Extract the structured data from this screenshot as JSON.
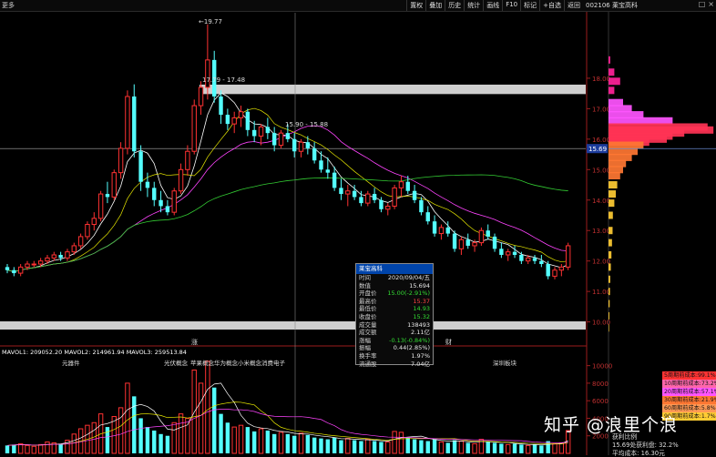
{
  "toolbar": {
    "more_label": "更多",
    "buttons": [
      "置权",
      "叠加",
      "历史",
      "统计",
      "画线",
      "F10",
      "标记",
      "+自选",
      "返回"
    ],
    "stock_title": "002106 莱宝高科"
  },
  "price_axis": {
    "ticks": [
      "18.00",
      "17.00",
      "16.00",
      "15.00",
      "14.00",
      "13.00",
      "12.00",
      "11.00",
      "10.00"
    ],
    "current_price_tag": "15.69"
  },
  "volume_axis": {
    "ticks": [
      "10000",
      "8000",
      "6000",
      "4000",
      "2000"
    ]
  },
  "chart_annotations": {
    "high_label": "19.77",
    "resistance_label": "17.79 - 17.48",
    "crosshair_label": "15.90 - 15.88",
    "event_label_1": "涨",
    "event_label_2": "财"
  },
  "volume_indicator": {
    "mavol1": "MAVOL1: 209052.20",
    "mavol2": "MAVOL2: 214961.94",
    "mavol3": "MAVOL3: 259513.84"
  },
  "concept_tags": [
    "元器件",
    "光伏概念",
    "苹果概念",
    "华为概念",
    "小米概念",
    "消费电子",
    "深圳板块"
  ],
  "popup": {
    "title": "莱宝高科",
    "rows": [
      {
        "label": "时间",
        "value": "2020/09/04/五",
        "color": "#e8e8e8"
      },
      {
        "label": "数值",
        "value": "15.694",
        "color": "#e8e8e8"
      },
      {
        "label": "开盘价",
        "value": "15.00(-2.91%)",
        "color": "#33dd33"
      },
      {
        "label": "最高价",
        "value": "15.37",
        "color": "#ff4444"
      },
      {
        "label": "最低价",
        "value": "14.93",
        "color": "#33dd33"
      },
      {
        "label": "收盘价",
        "value": "15.32",
        "color": "#33dd33"
      },
      {
        "label": "成交量",
        "value": "138493",
        "color": "#e8e8e8"
      },
      {
        "label": "成交额",
        "value": "2.11亿",
        "color": "#e8e8e8"
      },
      {
        "label": "涨幅",
        "value": "-0.13(-0.84%)",
        "color": "#33dd33"
      },
      {
        "label": "振幅",
        "value": "0.44(2.85%)",
        "color": "#e8e8e8"
      },
      {
        "label": "换手率",
        "value": "1.97%",
        "color": "#e8e8e8"
      },
      {
        "label": "流通股",
        "value": "7.04亿",
        "color": "#e8e8e8"
      }
    ]
  },
  "cost_distribution": [
    {
      "label": "5周期前成本:99.1%",
      "color": "#ff3333"
    },
    {
      "label": "10周期前成本:73.2%",
      "color": "#ff66aa"
    },
    {
      "label": "20周期前成本:57.1%",
      "color": "#ff55ff"
    },
    {
      "label": "30周期前成本:21.9%",
      "color": "#ff7733"
    },
    {
      "label": "60周期前成本:5.8%",
      "color": "#ff9955"
    },
    {
      "label": "90周期前成本:1.7%",
      "color": "#ffcc33"
    }
  ],
  "bottom_info": {
    "line1": "获利比例",
    "line2": "15.69处获利盘: 32.2%",
    "line3": "平均成本: 16.30元"
  },
  "watermark": "知乎 @浪里个浪",
  "chart_data": {
    "type": "candlestick",
    "ylim": [
      10.0,
      19.9
    ],
    "candles": [
      [
        11.8,
        11.9,
        11.6,
        11.7
      ],
      [
        11.7,
        11.8,
        11.5,
        11.6
      ],
      [
        11.6,
        11.9,
        11.5,
        11.8
      ],
      [
        11.8,
        12.0,
        11.7,
        11.9
      ],
      [
        11.9,
        12.0,
        11.8,
        11.9
      ],
      [
        11.9,
        12.1,
        11.8,
        12.0
      ],
      [
        12.0,
        12.2,
        11.9,
        12.1
      ],
      [
        12.1,
        12.3,
        12.0,
        12.2
      ],
      [
        12.2,
        12.3,
        12.0,
        12.1
      ],
      [
        12.1,
        12.4,
        12.0,
        12.3
      ],
      [
        12.3,
        12.6,
        12.2,
        12.5
      ],
      [
        12.5,
        12.9,
        12.4,
        12.8
      ],
      [
        12.8,
        13.3,
        12.7,
        13.2
      ],
      [
        13.2,
        13.6,
        13.0,
        13.4
      ],
      [
        13.4,
        14.3,
        13.3,
        14.2
      ],
      [
        14.2,
        14.6,
        13.9,
        14.1
      ],
      [
        14.1,
        15.0,
        14.0,
        14.9
      ],
      [
        14.9,
        15.9,
        14.7,
        15.7
      ],
      [
        15.7,
        17.6,
        15.5,
        17.4
      ],
      [
        17.4,
        17.8,
        15.4,
        15.6
      ],
      [
        15.6,
        15.8,
        14.3,
        14.6
      ],
      [
        14.6,
        14.9,
        14.1,
        14.4
      ],
      [
        14.4,
        14.6,
        13.8,
        14.0
      ],
      [
        14.0,
        14.3,
        13.6,
        13.8
      ],
      [
        13.8,
        14.0,
        13.5,
        13.6
      ],
      [
        13.6,
        14.4,
        13.5,
        14.3
      ],
      [
        14.3,
        15.2,
        14.2,
        15.0
      ],
      [
        15.0,
        15.8,
        14.8,
        15.6
      ],
      [
        15.6,
        17.3,
        15.5,
        17.1
      ],
      [
        17.1,
        17.9,
        16.8,
        17.7
      ],
      [
        17.7,
        19.77,
        17.3,
        18.6
      ],
      [
        18.6,
        18.9,
        17.2,
        17.4
      ],
      [
        17.4,
        17.6,
        16.5,
        16.8
      ],
      [
        16.8,
        17.0,
        16.3,
        16.5
      ],
      [
        16.5,
        16.9,
        16.2,
        16.7
      ],
      [
        16.7,
        17.1,
        16.4,
        16.9
      ],
      [
        16.9,
        17.0,
        16.1,
        16.3
      ],
      [
        16.3,
        16.6,
        15.9,
        16.1
      ],
      [
        16.1,
        16.5,
        15.8,
        16.4
      ],
      [
        16.4,
        16.7,
        16.0,
        16.2
      ],
      [
        16.2,
        16.4,
        15.6,
        15.8
      ],
      [
        15.8,
        16.3,
        15.7,
        16.2
      ],
      [
        16.2,
        16.5,
        15.9,
        16.0
      ],
      [
        16.0,
        16.2,
        15.4,
        15.6
      ],
      [
        15.6,
        16.0,
        15.4,
        15.9
      ],
      [
        15.9,
        16.1,
        15.5,
        15.7
      ],
      [
        15.7,
        15.9,
        15.2,
        15.3
      ],
      [
        15.3,
        15.6,
        14.9,
        15.0
      ],
      [
        15.0,
        15.4,
        14.7,
        14.9
      ],
      [
        14.9,
        15.1,
        14.3,
        14.4
      ],
      [
        14.4,
        14.7,
        14.0,
        14.2
      ],
      [
        14.2,
        14.5,
        13.8,
        14.3
      ],
      [
        14.3,
        14.5,
        14.0,
        14.1
      ],
      [
        14.1,
        14.3,
        13.8,
        13.9
      ],
      [
        13.9,
        14.3,
        13.8,
        14.2
      ],
      [
        14.2,
        14.4,
        13.9,
        14.0
      ],
      [
        14.0,
        14.1,
        13.6,
        13.7
      ],
      [
        13.7,
        13.9,
        13.5,
        13.8
      ],
      [
        13.8,
        14.5,
        13.7,
        14.4
      ],
      [
        14.4,
        14.8,
        14.1,
        14.6
      ],
      [
        14.6,
        14.8,
        14.2,
        14.3
      ],
      [
        14.3,
        14.5,
        13.9,
        14.0
      ],
      [
        14.0,
        14.1,
        13.5,
        13.6
      ],
      [
        13.6,
        13.8,
        13.2,
        13.3
      ],
      [
        13.3,
        13.5,
        12.8,
        12.9
      ],
      [
        12.9,
        13.2,
        12.7,
        13.1
      ],
      [
        13.1,
        13.3,
        12.8,
        12.9
      ],
      [
        12.9,
        13.0,
        12.3,
        12.4
      ],
      [
        12.4,
        12.8,
        12.2,
        12.7
      ],
      [
        12.7,
        12.9,
        12.4,
        12.5
      ],
      [
        12.5,
        12.7,
        12.3,
        12.6
      ],
      [
        12.6,
        13.1,
        12.5,
        13.0
      ],
      [
        13.0,
        13.2,
        12.7,
        12.8
      ],
      [
        12.8,
        12.9,
        12.3,
        12.4
      ],
      [
        12.4,
        12.6,
        12.1,
        12.2
      ],
      [
        12.2,
        12.4,
        12.0,
        12.3
      ],
      [
        12.3,
        12.5,
        12.1,
        12.2
      ],
      [
        12.2,
        12.3,
        11.9,
        12.0
      ],
      [
        12.0,
        12.2,
        11.9,
        12.1
      ],
      [
        12.1,
        12.2,
        11.9,
        12.0
      ],
      [
        12.0,
        12.2,
        11.8,
        11.9
      ],
      [
        11.9,
        12.0,
        11.4,
        11.5
      ],
      [
        11.5,
        11.8,
        11.4,
        11.7
      ],
      [
        11.7,
        11.9,
        11.5,
        11.8
      ],
      [
        11.8,
        12.6,
        11.7,
        12.5
      ]
    ],
    "volumes": [
      900,
      1000,
      1100,
      900,
      800,
      1000,
      1300,
      1200,
      1100,
      1500,
      2200,
      2800,
      3200,
      3500,
      4500,
      3000,
      4200,
      5200,
      8000,
      6500,
      4000,
      3000,
      2600,
      2200,
      2000,
      3500,
      4500,
      4000,
      9500,
      8000,
      10500,
      7500,
      4500,
      3500,
      3000,
      3200,
      3000,
      2500,
      2800,
      2600,
      2200,
      2400,
      2200,
      2000,
      2300,
      2100,
      1800,
      1700,
      1600,
      1800,
      1500,
      1700,
      1500,
      1400,
      1600,
      1400,
      1300,
      1300,
      2500,
      2400,
      1800,
      1600,
      1500,
      1400,
      1600,
      1300,
      1200,
      1500,
      1400,
      1200,
      1100,
      1600,
      1300,
      1200,
      1100,
      1000,
      1100,
      1000,
      900,
      1000,
      900,
      1400,
      1100,
      1200,
      2600
    ]
  }
}
